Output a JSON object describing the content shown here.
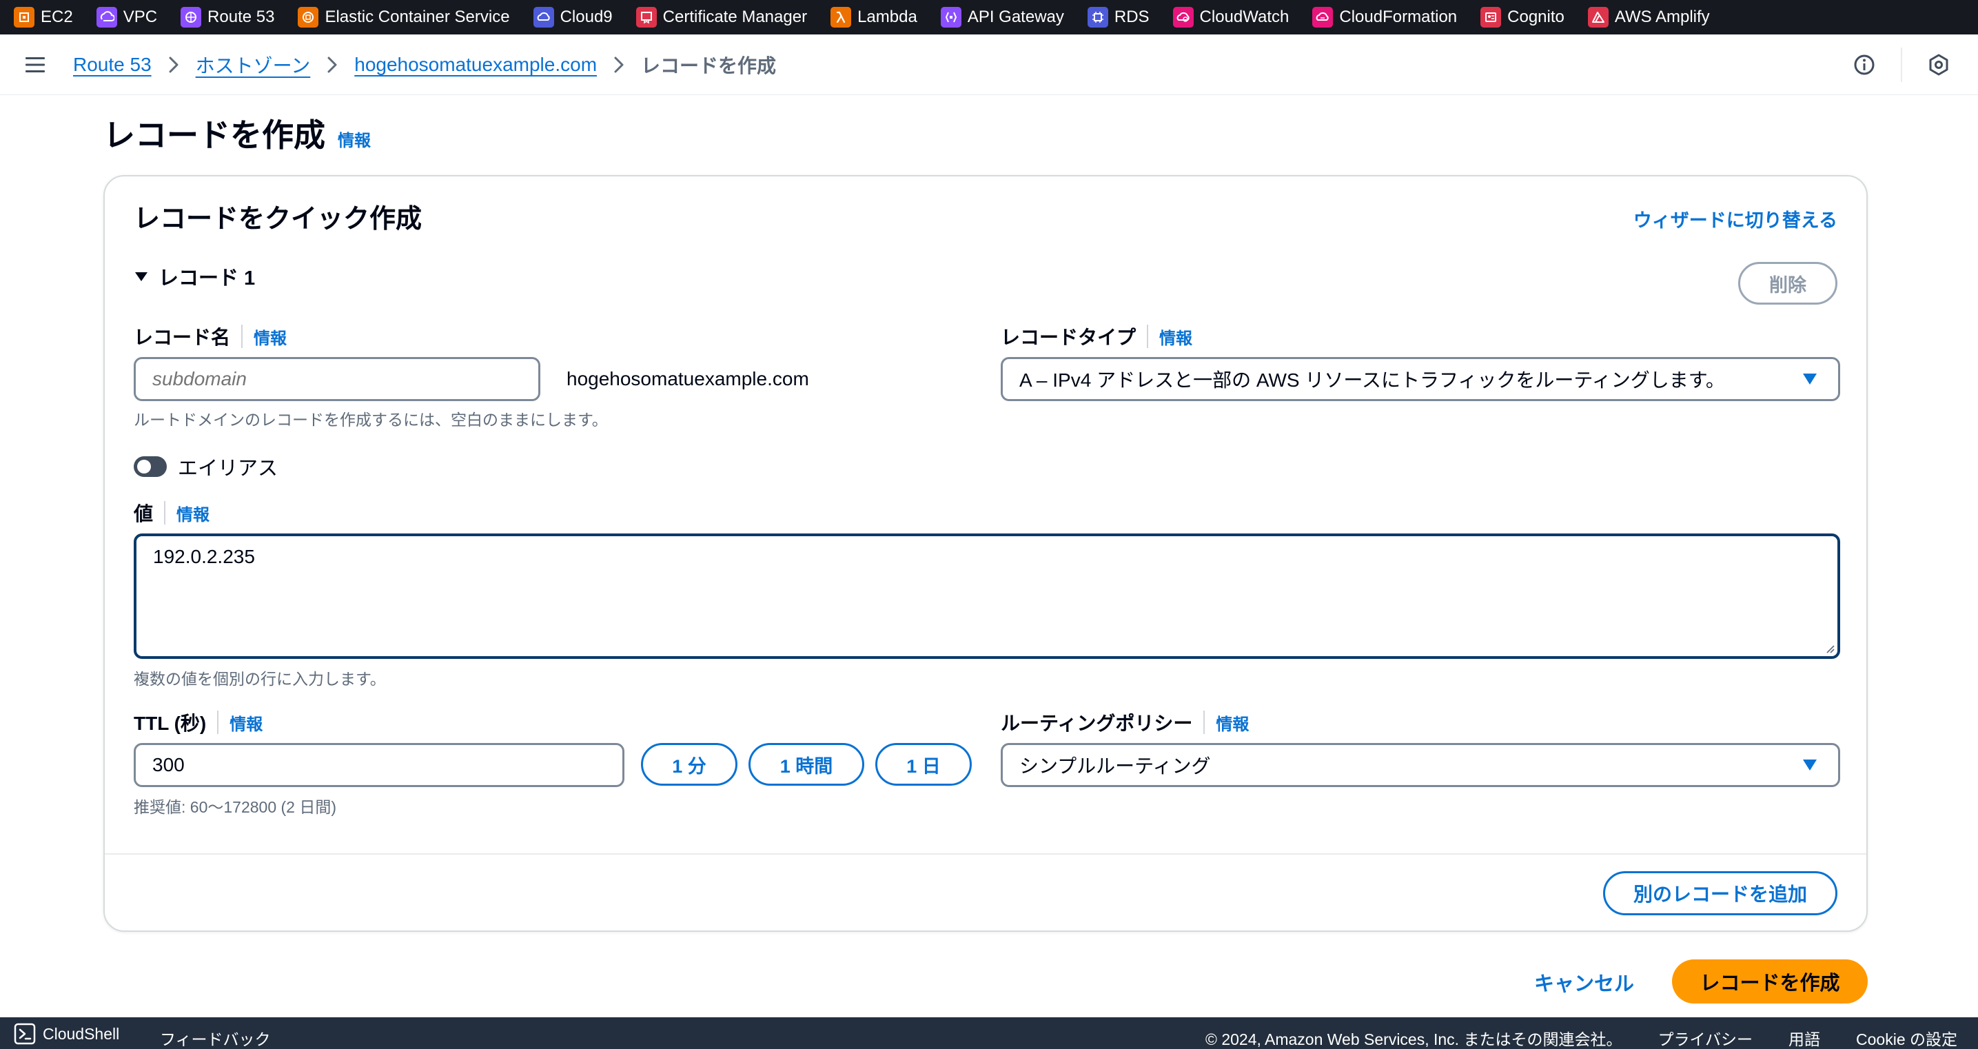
{
  "service_bar": [
    {
      "name": "ec2",
      "label": "EC2",
      "color": "#ed7100"
    },
    {
      "name": "vpc",
      "label": "VPC",
      "color": "#8c4fff"
    },
    {
      "name": "route53",
      "label": "Route 53",
      "color": "#8c4fff"
    },
    {
      "name": "ecs",
      "label": "Elastic Container Service",
      "color": "#ed7100"
    },
    {
      "name": "cloud9",
      "label": "Cloud9",
      "color": "#4d5bd9"
    },
    {
      "name": "acm",
      "label": "Certificate Manager",
      "color": "#dd344c"
    },
    {
      "name": "lambda",
      "label": "Lambda",
      "color": "#ed7100"
    },
    {
      "name": "apigateway",
      "label": "API Gateway",
      "color": "#8c4fff"
    },
    {
      "name": "rds",
      "label": "RDS",
      "color": "#4d5bd9"
    },
    {
      "name": "cloudwatch",
      "label": "CloudWatch",
      "color": "#e7157b"
    },
    {
      "name": "cloudformation",
      "label": "CloudFormation",
      "color": "#e7157b"
    },
    {
      "name": "cognito",
      "label": "Cognito",
      "color": "#dd344c"
    },
    {
      "name": "amplify",
      "label": "AWS Amplify",
      "color": "#dd344c"
    }
  ],
  "breadcrumb": {
    "route53": "Route 53",
    "hosted_zones": "ホストゾーン",
    "zone": "hogehosomatuexample.com",
    "current": "レコードを作成"
  },
  "page": {
    "title": "レコードを作成",
    "info": "情報"
  },
  "card": {
    "title": "レコードをクイック作成",
    "wizard_link": "ウィザードに切り替える",
    "record_header": "レコード 1",
    "delete_label": "削除",
    "record_name": {
      "label": "レコード名",
      "info": "情報",
      "placeholder": "subdomain",
      "domain_suffix": "hogehosomatuexample.com",
      "hint": "ルートドメインのレコードを作成するには、空白のままにします。"
    },
    "record_type": {
      "label": "レコードタイプ",
      "info": "情報",
      "value": "A – IPv4 アドレスと一部の AWS リソースにトラフィックをルーティングします。"
    },
    "alias": {
      "label": "エイリアス",
      "enabled": false
    },
    "value_field": {
      "label": "値",
      "info": "情報",
      "value": "192.0.2.235",
      "hint": "複数の値を個別の行に入力します。"
    },
    "ttl": {
      "label": "TTL (秒)",
      "info": "情報",
      "value": "300",
      "hint": "推奨値: 60〜172800 (2 日間)",
      "btn_1min": "1 分",
      "btn_1hour": "1 時間",
      "btn_1day": "1 日"
    },
    "routing_policy": {
      "label": "ルーティングポリシー",
      "info": "情報",
      "value": "シンプルルーティング"
    },
    "add_record": "別のレコードを追加"
  },
  "actions": {
    "cancel": "キャンセル",
    "create": "レコードを作成"
  },
  "footer": {
    "cloudshell": "CloudShell",
    "feedback": "フィードバック",
    "copyright": "© 2024, Amazon Web Services, Inc. またはその関連会社。",
    "privacy": "プライバシー",
    "terms": "用語",
    "cookie": "Cookie の設定"
  },
  "colors": {
    "accent": "#0972d3",
    "primary_button": "#ff9900",
    "top_bar": "#16191f",
    "footer_bar": "#232f3e"
  }
}
